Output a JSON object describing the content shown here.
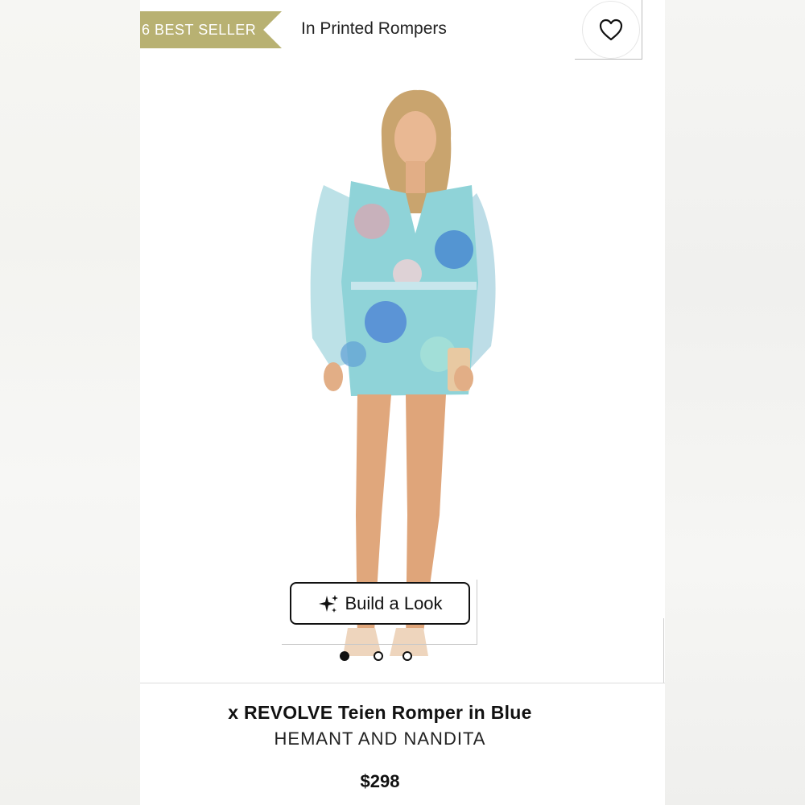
{
  "badge": {
    "label": "6 BEST SELLER",
    "color": "#b8b172"
  },
  "header": {
    "category": "In Printed Rompers"
  },
  "favorite": {
    "icon": "heart-icon"
  },
  "build_look": {
    "label": "Build a Look",
    "icon": "sparkles-icon"
  },
  "carousel": {
    "count": 3,
    "active_index": 0
  },
  "product": {
    "title": "x REVOLVE Teien Romper in Blue",
    "brand": "HEMANT AND NANDITA",
    "price": "$298"
  }
}
